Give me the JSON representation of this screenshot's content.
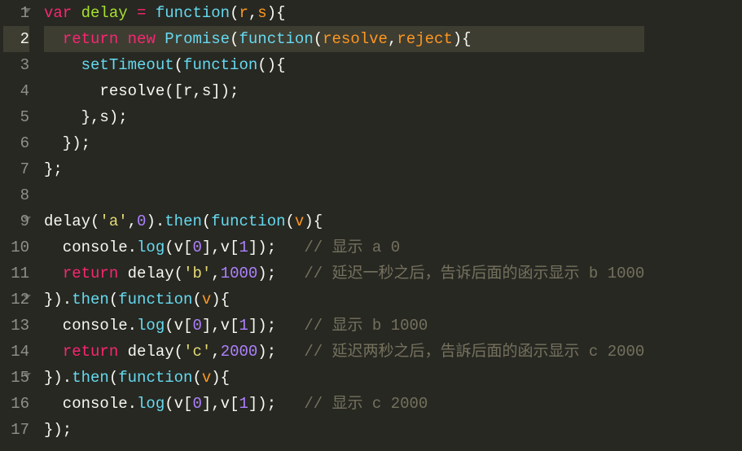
{
  "lines": [
    {
      "num": "1",
      "fold": true,
      "highlight": false,
      "tokens": [
        {
          "cls": "tok-keyword",
          "t": "var"
        },
        {
          "cls": "tok-plain",
          "t": " "
        },
        {
          "cls": "tok-funcname",
          "t": "delay"
        },
        {
          "cls": "tok-plain",
          "t": " "
        },
        {
          "cls": "tok-keyword",
          "t": "="
        },
        {
          "cls": "tok-plain",
          "t": " "
        },
        {
          "cls": "tok-builtin",
          "t": "function"
        },
        {
          "cls": "tok-punc",
          "t": "("
        },
        {
          "cls": "tok-param",
          "t": "r"
        },
        {
          "cls": "tok-punc",
          "t": ","
        },
        {
          "cls": "tok-param",
          "t": "s"
        },
        {
          "cls": "tok-punc",
          "t": "){"
        }
      ]
    },
    {
      "num": "2",
      "fold": false,
      "highlight": true,
      "tokens": [
        {
          "cls": "tok-plain",
          "t": "  "
        },
        {
          "cls": "tok-keyword",
          "t": "return"
        },
        {
          "cls": "tok-plain",
          "t": " "
        },
        {
          "cls": "tok-keyword",
          "t": "new"
        },
        {
          "cls": "tok-plain",
          "t": " "
        },
        {
          "cls": "tok-builtin",
          "t": "Promise"
        },
        {
          "cls": "tok-punc",
          "t": "("
        },
        {
          "cls": "tok-builtin",
          "t": "function"
        },
        {
          "cls": "tok-punc",
          "t": "("
        },
        {
          "cls": "tok-param",
          "t": "resolve"
        },
        {
          "cls": "tok-punc",
          "t": ","
        },
        {
          "cls": "tok-param",
          "t": "reject"
        },
        {
          "cls": "tok-punc",
          "t": "){"
        }
      ]
    },
    {
      "num": "3",
      "fold": false,
      "highlight": false,
      "tokens": [
        {
          "cls": "tok-plain",
          "t": "    "
        },
        {
          "cls": "tok-builtin",
          "t": "setTimeout"
        },
        {
          "cls": "tok-punc",
          "t": "("
        },
        {
          "cls": "tok-builtin",
          "t": "function"
        },
        {
          "cls": "tok-punc",
          "t": "(){"
        }
      ]
    },
    {
      "num": "4",
      "fold": false,
      "highlight": false,
      "tokens": [
        {
          "cls": "tok-plain",
          "t": "      resolve([r,s]);"
        }
      ]
    },
    {
      "num": "5",
      "fold": false,
      "highlight": false,
      "tokens": [
        {
          "cls": "tok-plain",
          "t": "    },s);"
        }
      ]
    },
    {
      "num": "6",
      "fold": false,
      "highlight": false,
      "tokens": [
        {
          "cls": "tok-plain",
          "t": "  });"
        }
      ]
    },
    {
      "num": "7",
      "fold": false,
      "highlight": false,
      "tokens": [
        {
          "cls": "tok-plain",
          "t": "};"
        }
      ]
    },
    {
      "num": "8",
      "fold": false,
      "highlight": false,
      "tokens": [
        {
          "cls": "tok-plain",
          "t": ""
        }
      ]
    },
    {
      "num": "9",
      "fold": true,
      "highlight": false,
      "tokens": [
        {
          "cls": "tok-plain",
          "t": "delay("
        },
        {
          "cls": "tok-string",
          "t": "'a'"
        },
        {
          "cls": "tok-plain",
          "t": ","
        },
        {
          "cls": "tok-number",
          "t": "0"
        },
        {
          "cls": "tok-plain",
          "t": ")."
        },
        {
          "cls": "tok-method",
          "t": "then"
        },
        {
          "cls": "tok-punc",
          "t": "("
        },
        {
          "cls": "tok-builtin",
          "t": "function"
        },
        {
          "cls": "tok-punc",
          "t": "("
        },
        {
          "cls": "tok-param",
          "t": "v"
        },
        {
          "cls": "tok-punc",
          "t": "){"
        }
      ]
    },
    {
      "num": "10",
      "fold": false,
      "highlight": false,
      "tokens": [
        {
          "cls": "tok-plain",
          "t": "  console."
        },
        {
          "cls": "tok-method",
          "t": "log"
        },
        {
          "cls": "tok-plain",
          "t": "(v["
        },
        {
          "cls": "tok-number",
          "t": "0"
        },
        {
          "cls": "tok-plain",
          "t": "],v["
        },
        {
          "cls": "tok-number",
          "t": "1"
        },
        {
          "cls": "tok-plain",
          "t": "]);   "
        },
        {
          "cls": "tok-comment",
          "t": "// 显示 a 0"
        }
      ]
    },
    {
      "num": "11",
      "fold": false,
      "highlight": false,
      "tokens": [
        {
          "cls": "tok-plain",
          "t": "  "
        },
        {
          "cls": "tok-keyword",
          "t": "return"
        },
        {
          "cls": "tok-plain",
          "t": " delay("
        },
        {
          "cls": "tok-string",
          "t": "'b'"
        },
        {
          "cls": "tok-plain",
          "t": ","
        },
        {
          "cls": "tok-number",
          "t": "1000"
        },
        {
          "cls": "tok-plain",
          "t": ");   "
        },
        {
          "cls": "tok-comment",
          "t": "// 延迟一秒之后，告诉后面的函示显示 b 1000"
        }
      ]
    },
    {
      "num": "12",
      "fold": true,
      "highlight": false,
      "tokens": [
        {
          "cls": "tok-plain",
          "t": "})."
        },
        {
          "cls": "tok-method",
          "t": "then"
        },
        {
          "cls": "tok-punc",
          "t": "("
        },
        {
          "cls": "tok-builtin",
          "t": "function"
        },
        {
          "cls": "tok-punc",
          "t": "("
        },
        {
          "cls": "tok-param",
          "t": "v"
        },
        {
          "cls": "tok-punc",
          "t": "){"
        }
      ]
    },
    {
      "num": "13",
      "fold": false,
      "highlight": false,
      "tokens": [
        {
          "cls": "tok-plain",
          "t": "  console."
        },
        {
          "cls": "tok-method",
          "t": "log"
        },
        {
          "cls": "tok-plain",
          "t": "(v["
        },
        {
          "cls": "tok-number",
          "t": "0"
        },
        {
          "cls": "tok-plain",
          "t": "],v["
        },
        {
          "cls": "tok-number",
          "t": "1"
        },
        {
          "cls": "tok-plain",
          "t": "]);   "
        },
        {
          "cls": "tok-comment",
          "t": "// 显示 b 1000"
        }
      ]
    },
    {
      "num": "14",
      "fold": false,
      "highlight": false,
      "tokens": [
        {
          "cls": "tok-plain",
          "t": "  "
        },
        {
          "cls": "tok-keyword",
          "t": "return"
        },
        {
          "cls": "tok-plain",
          "t": " delay("
        },
        {
          "cls": "tok-string",
          "t": "'c'"
        },
        {
          "cls": "tok-plain",
          "t": ","
        },
        {
          "cls": "tok-number",
          "t": "2000"
        },
        {
          "cls": "tok-plain",
          "t": ");   "
        },
        {
          "cls": "tok-comment",
          "t": "// 延迟两秒之后，告訴后面的函示显示 c 2000"
        }
      ]
    },
    {
      "num": "15",
      "fold": true,
      "highlight": false,
      "tokens": [
        {
          "cls": "tok-plain",
          "t": "})."
        },
        {
          "cls": "tok-method",
          "t": "then"
        },
        {
          "cls": "tok-punc",
          "t": "("
        },
        {
          "cls": "tok-builtin",
          "t": "function"
        },
        {
          "cls": "tok-punc",
          "t": "("
        },
        {
          "cls": "tok-param",
          "t": "v"
        },
        {
          "cls": "tok-punc",
          "t": "){"
        }
      ]
    },
    {
      "num": "16",
      "fold": false,
      "highlight": false,
      "tokens": [
        {
          "cls": "tok-plain",
          "t": "  console."
        },
        {
          "cls": "tok-method",
          "t": "log"
        },
        {
          "cls": "tok-plain",
          "t": "(v["
        },
        {
          "cls": "tok-number",
          "t": "0"
        },
        {
          "cls": "tok-plain",
          "t": "],v["
        },
        {
          "cls": "tok-number",
          "t": "1"
        },
        {
          "cls": "tok-plain",
          "t": "]);   "
        },
        {
          "cls": "tok-comment",
          "t": "// 显示 c 2000"
        }
      ]
    },
    {
      "num": "17",
      "fold": false,
      "highlight": false,
      "tokens": [
        {
          "cls": "tok-plain",
          "t": "});"
        }
      ]
    }
  ]
}
